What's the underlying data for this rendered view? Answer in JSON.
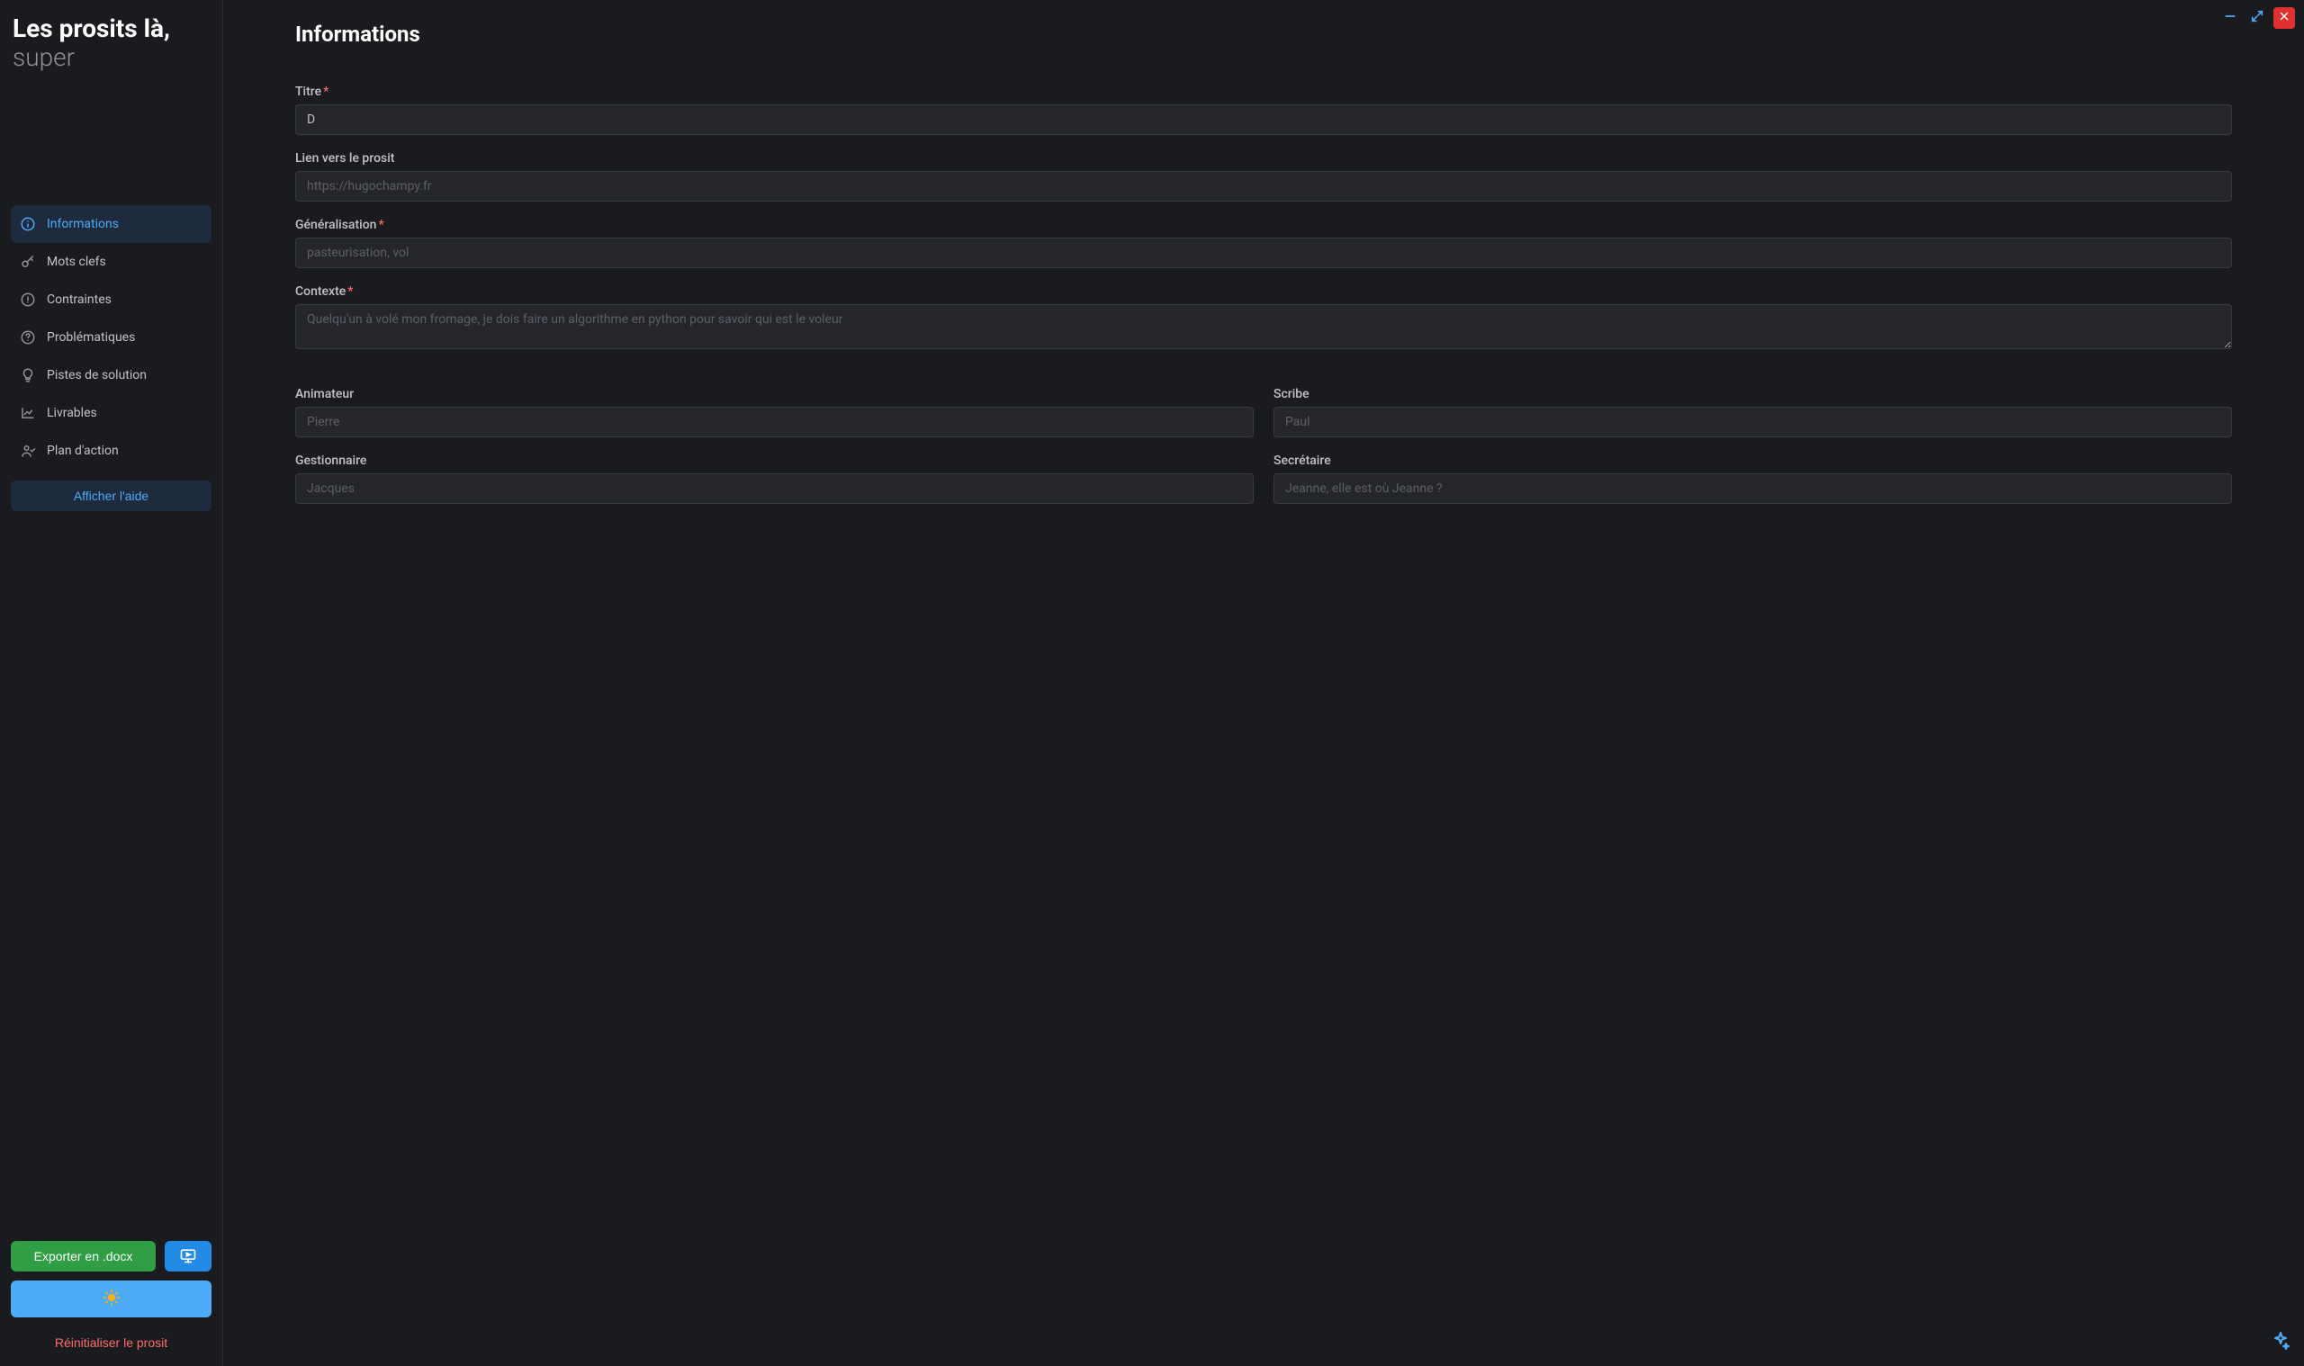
{
  "brand": {
    "line1": "Les prosits là,",
    "line2": "super"
  },
  "nav": {
    "items": [
      {
        "label": "Informations",
        "icon": "info-icon",
        "active": true
      },
      {
        "label": "Mots clefs",
        "icon": "key-icon",
        "active": false
      },
      {
        "label": "Contraintes",
        "icon": "alert-icon",
        "active": false
      },
      {
        "label": "Problématiques",
        "icon": "question-icon",
        "active": false
      },
      {
        "label": "Pistes de solution",
        "icon": "bulb-icon",
        "active": false
      },
      {
        "label": "Livrables",
        "icon": "chart-icon",
        "active": false
      },
      {
        "label": "Plan d'action",
        "icon": "user-check-icon",
        "active": false
      }
    ],
    "help_label": "Afficher l'aide"
  },
  "sidebar_actions": {
    "export_label": "Exporter en .docx",
    "reset_label": "Réinitialiser le prosit"
  },
  "page": {
    "title": "Informations"
  },
  "form": {
    "titre": {
      "label": "Titre",
      "required": true,
      "value": "D",
      "placeholder": ""
    },
    "lien": {
      "label": "Lien vers le prosit",
      "required": false,
      "value": "",
      "placeholder": "https://hugochampy.fr"
    },
    "generalisation": {
      "label": "Généralisation",
      "required": true,
      "value": "",
      "placeholder": "pasteurisation, vol"
    },
    "contexte": {
      "label": "Contexte",
      "required": true,
      "value": "",
      "placeholder": "Quelqu'un à volé mon fromage, je dois faire un algorithme en python pour savoir qui est le voleur"
    },
    "animateur": {
      "label": "Animateur",
      "required": false,
      "value": "",
      "placeholder": "Pierre"
    },
    "scribe": {
      "label": "Scribe",
      "required": false,
      "value": "",
      "placeholder": "Paul"
    },
    "gestionnaire": {
      "label": "Gestionnaire",
      "required": false,
      "value": "",
      "placeholder": "Jacques"
    },
    "secretaire": {
      "label": "Secrétaire",
      "required": false,
      "value": "",
      "placeholder": "Jeanne, elle est où Jeanne ?"
    }
  },
  "colors": {
    "accent": "#228be6",
    "danger": "#e03131",
    "success": "#2f9e44"
  }
}
